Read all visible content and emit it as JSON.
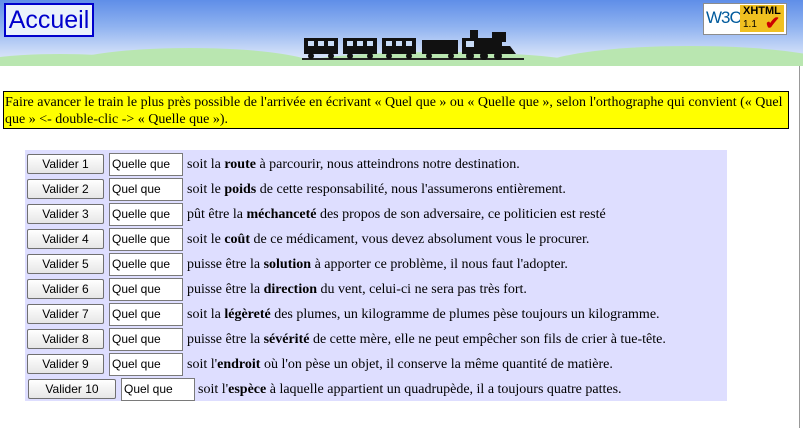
{
  "header": {
    "home_label": "Accueil",
    "badge": {
      "w3c": "W3C",
      "xhtml": "XHTML",
      "version": "1.1",
      "check": "✔"
    }
  },
  "instructions": "Faire avancer le train le plus près possible de l'arrivée en écrivant « Quel que » ou « Quelle que », selon l'orthographe qui convient (« Quel que » <- double-clic -> « Quelle que »).",
  "rows": [
    {
      "button": "Valider 1",
      "value": "Quelle que",
      "pre": "soit la ",
      "bold": "route",
      "post": " à parcourir, nous atteindrons notre destination."
    },
    {
      "button": "Valider 2",
      "value": "Quel que",
      "pre": "soit le ",
      "bold": "poids",
      "post": " de cette responsabilité, nous l'assumerons entièrement."
    },
    {
      "button": "Valider 3",
      "value": "Quelle que",
      "pre": "pût être la ",
      "bold": "méchanceté",
      "post": " des propos de son adversaire, ce politicien est resté"
    },
    {
      "button": "Valider 4",
      "value": "Quelle que",
      "pre": "soit le ",
      "bold": "coût",
      "post": " de ce médicament, vous devez absolument vous le procurer."
    },
    {
      "button": "Valider 5",
      "value": "Quelle que",
      "pre": "puisse être la ",
      "bold": "solution",
      "post": " à apporter ce problème, il nous faut l'adopter."
    },
    {
      "button": "Valider 6",
      "value": "Quel que",
      "pre": "puisse être la ",
      "bold": "direction",
      "post": " du vent, celui-ci ne sera pas très fort."
    },
    {
      "button": "Valider 7",
      "value": "Quel que",
      "pre": "soit la ",
      "bold": "légèreté",
      "post": " des plumes, un kilogramme de plumes pèse toujours un kilogramme."
    },
    {
      "button": "Valider 8",
      "value": "Quel que",
      "pre": "puisse être la ",
      "bold": "sévérité",
      "post": " de cette mère, elle ne peut empêcher son fils de crier à tue-tête."
    },
    {
      "button": "Valider 9",
      "value": "Quel que",
      "pre": "soit l'",
      "bold": "endroit",
      "post": " où l'on pèse un objet, il conserve la même quantité de matière."
    },
    {
      "button": "Valider 10",
      "value": "Quel que",
      "pre": "soit l'",
      "bold": "espèce",
      "post": " à laquelle appartient un quadrupède, il a toujours quatre pattes."
    }
  ]
}
